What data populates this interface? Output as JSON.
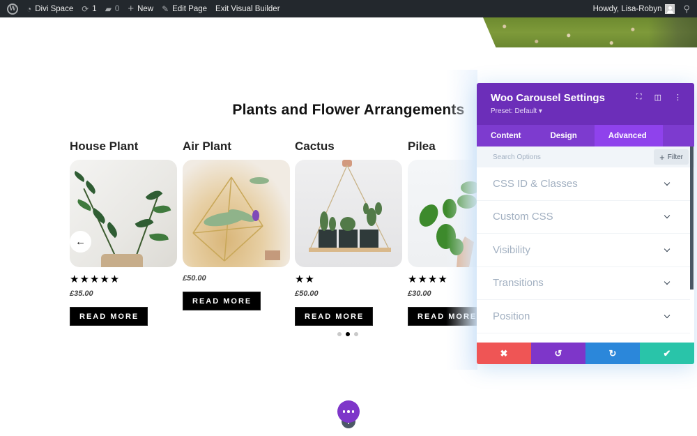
{
  "admin_bar": {
    "site_name": "Divi Space",
    "updates_count": "1",
    "comments_count": "0",
    "new_label": "New",
    "edit_page_label": "Edit Page",
    "exit_builder_label": "Exit Visual Builder",
    "greeting": "Howdy, Lisa-Robyn",
    "icons": [
      "wordpress-logo-icon",
      "dashboard-icon",
      "updates-icon",
      "comment-icon",
      "plus-icon",
      "pencil-icon",
      "avatar-icon",
      "search-icon"
    ]
  },
  "section": {
    "title": "Plants and Flower Arrangements"
  },
  "products": [
    {
      "name": "House Plant",
      "rating": 5,
      "stars": "★★★★★",
      "price": "£35.00",
      "button": "READ MORE"
    },
    {
      "name": "Air Plant",
      "rating": 0,
      "stars": "",
      "price": "£50.00",
      "button": "READ MORE"
    },
    {
      "name": "Cactus",
      "rating": 2,
      "stars": "★★",
      "price": "£50.00",
      "button": "READ MORE"
    },
    {
      "name": "Pilea",
      "rating": 4,
      "stars": "★★★★",
      "price": "£30.00",
      "button": "READ MORE"
    }
  ],
  "carousel": {
    "prev_arrow": "←",
    "dots_total": 3,
    "active_dot": 2
  },
  "settings_panel": {
    "title": "Woo Carousel Settings",
    "preset": "Preset: Default ▾",
    "header_icons": [
      "fullscreen-icon",
      "split-view-icon",
      "more-options-icon"
    ],
    "tabs": [
      {
        "label": "Content",
        "active": false
      },
      {
        "label": "Design",
        "active": false
      },
      {
        "label": "Advanced",
        "active": true
      }
    ],
    "search_placeholder": "Search Options",
    "filter_label": "Filter",
    "options": [
      {
        "label": "CSS ID & Classes"
      },
      {
        "label": "Custom CSS"
      },
      {
        "label": "Visibility"
      },
      {
        "label": "Transitions"
      },
      {
        "label": "Position"
      }
    ],
    "actions": {
      "cancel": "✖",
      "undo": "↺",
      "redo": "↻",
      "save": "✔"
    },
    "colors": {
      "header": "#6c2eb9",
      "tabs": "#7d3bcf",
      "active_tab": "#8f42ec",
      "cancel": "#ef5555",
      "undo": "#7e36c9",
      "redo": "#2b87da",
      "save": "#29c4a9"
    }
  }
}
